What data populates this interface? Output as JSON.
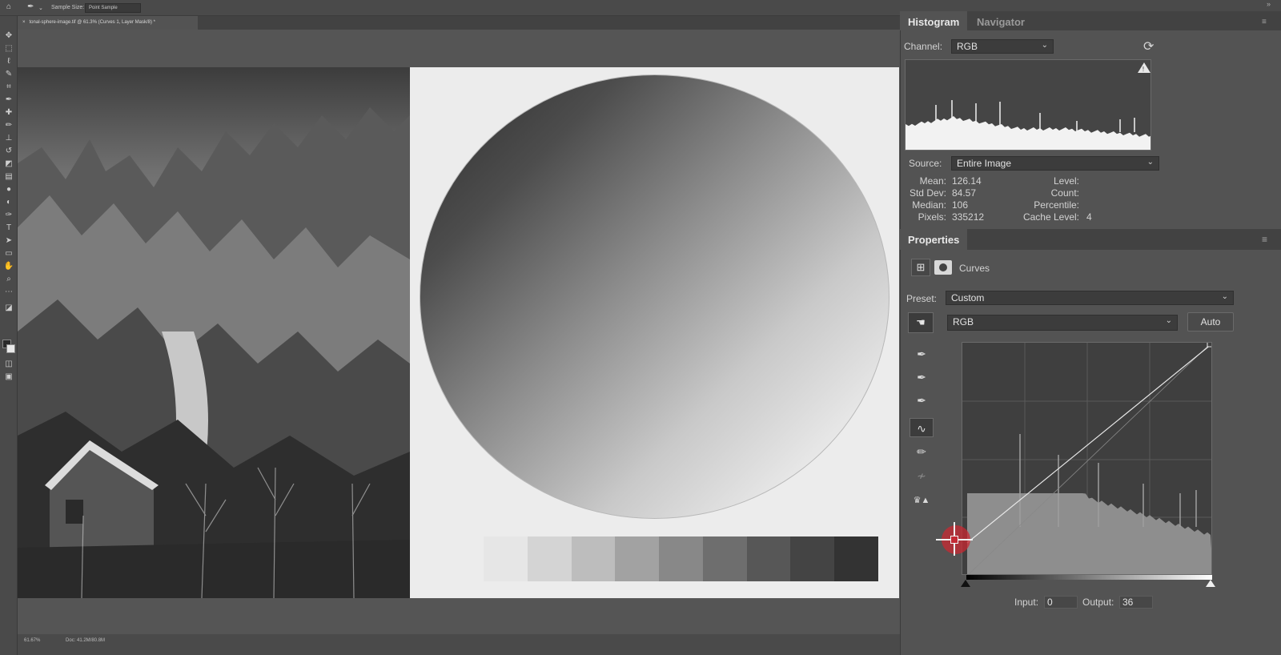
{
  "options_bar": {
    "home_icon": "home-icon",
    "tool_icon": "eyedropper-icon",
    "sample_size_label": "Sample Size:",
    "sample_size_value": "Point Sample"
  },
  "document": {
    "tab_title": "tonal-sphere-image.tif @ 61.3% (Curves 1, Layer Mask/8) *",
    "status_zoom": "61.67%",
    "status_doc": "Doc: 41.2M/80.8M"
  },
  "swatch_colors": [
    "#e6e6e6",
    "#d4d4d4",
    "#bdbdbd",
    "#a2a2a2",
    "#888888",
    "#6e6e6e",
    "#575757",
    "#444444",
    "#333333"
  ],
  "histogram_panel": {
    "tabs": [
      "Histogram",
      "Navigator"
    ],
    "channel_label": "Channel:",
    "channel_value": "RGB",
    "source_label": "Source:",
    "source_value": "Entire Image",
    "stats_left": [
      {
        "label": "Mean:",
        "value": "126.14"
      },
      {
        "label": "Std Dev:",
        "value": "84.57"
      },
      {
        "label": "Median:",
        "value": "106"
      },
      {
        "label": "Pixels:",
        "value": "335212"
      }
    ],
    "stats_right": [
      {
        "label": "Level:",
        "value": ""
      },
      {
        "label": "Count:",
        "value": ""
      },
      {
        "label": "Percentile:",
        "value": ""
      },
      {
        "label": "Cache Level:",
        "value": "4"
      }
    ]
  },
  "properties_panel": {
    "tab": "Properties",
    "adjustment_name": "Curves",
    "preset_label": "Preset:",
    "preset_value": "Custom",
    "channel_value": "RGB",
    "auto_button": "Auto",
    "input_label": "Input:",
    "input_value": "0",
    "output_label": "Output:",
    "output_value": "36"
  }
}
